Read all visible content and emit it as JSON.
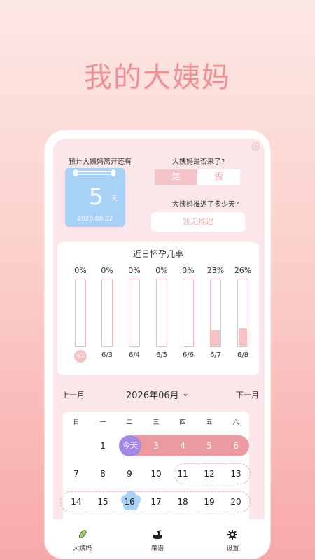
{
  "hero": {
    "title": "我的大姨妈"
  },
  "countdown": {
    "label": "预计大姨妈离开还有",
    "days": "5",
    "unit": "天",
    "date": "2026.06.02"
  },
  "period_came": {
    "label": "大姨妈是否来了?",
    "yes": "是",
    "no": "否",
    "selected": "是"
  },
  "delay": {
    "label": "大姨妈推迟了多少天?",
    "button": "暂无推迟"
  },
  "chart_data": {
    "type": "bar",
    "title": "近日怀孕几率",
    "categories": [
      "今天",
      "6/3",
      "6/4",
      "6/5",
      "6/6",
      "6/7",
      "6/8"
    ],
    "values": [
      0,
      0,
      0,
      0,
      0,
      23,
      26
    ],
    "value_labels": [
      "0%",
      "0%",
      "0%",
      "0%",
      "0%",
      "23%",
      "26%"
    ],
    "ylim": [
      0,
      100
    ],
    "grid": false
  },
  "month_nav": {
    "prev": "上一月",
    "title": "2026年06月",
    "next": "下一月"
  },
  "calendar": {
    "weekdays": [
      "日",
      "一",
      "二",
      "三",
      "四",
      "五",
      "六"
    ],
    "rows": [
      [
        "",
        "1",
        "今天",
        "3",
        "4",
        "5",
        "6"
      ],
      [
        "7",
        "8",
        "9",
        "10",
        "11",
        "12",
        "13"
      ],
      [
        "14",
        "15",
        "16",
        "17",
        "18",
        "19",
        "20"
      ]
    ]
  },
  "tabs": [
    {
      "label": "大姨妈",
      "icon": "pad-icon"
    },
    {
      "label": "菜谱",
      "icon": "cooking-pot-icon"
    },
    {
      "label": "设置",
      "icon": "gear-icon"
    }
  ],
  "colors": {
    "accent": "#f08f96",
    "period": "#eb9ba0",
    "today": "#a587e6",
    "ovulation": "#a8d1f7"
  }
}
